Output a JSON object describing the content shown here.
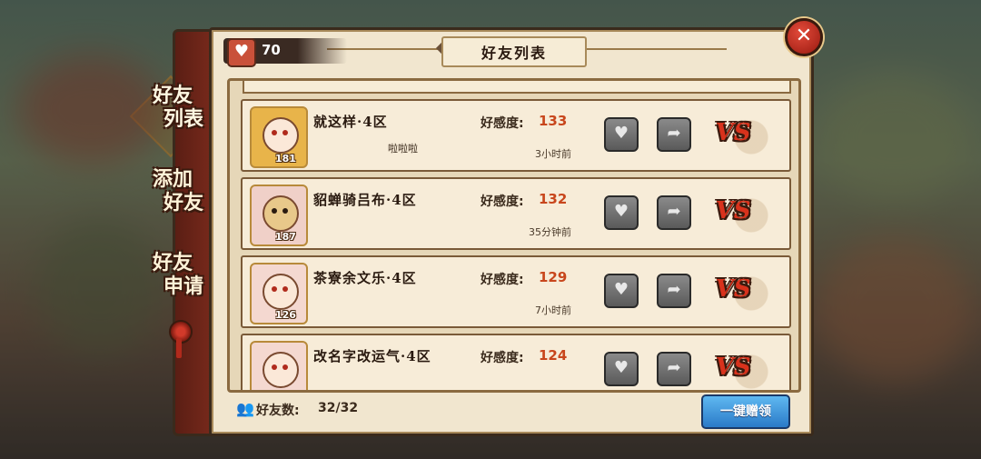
{
  "window": {
    "title": "好友列表"
  },
  "tabs": [
    {
      "line1": "好友",
      "line2": "列表",
      "active": true
    },
    {
      "line1": "添加",
      "line2": "好友",
      "active": false
    },
    {
      "line1": "好友",
      "line2": "申请",
      "active": false
    }
  ],
  "hearts": {
    "count": "70",
    "icon": "heart-icon"
  },
  "affinity_label": "好感度:",
  "friends": [
    {
      "name": "就这样·4区",
      "signature": "啦啦啦",
      "affinity": "133",
      "last_seen": "3小时前",
      "level": "181",
      "avatar_color": "#e8b44a"
    },
    {
      "name": "貂蝉骑吕布·4区",
      "signature": "",
      "affinity": "132",
      "last_seen": "35分钟前",
      "level": "187",
      "avatar_color": "#f0d0c8"
    },
    {
      "name": "茶寮余文乐·4区",
      "signature": "",
      "affinity": "129",
      "last_seen": "7小时前",
      "level": "126",
      "avatar_color": "#f4d8d0"
    },
    {
      "name": "改名字改运气·4区",
      "signature": "",
      "affinity": "124",
      "last_seen": "",
      "level": "",
      "avatar_color": "#f4d8d0"
    }
  ],
  "footer": {
    "friend_count_label": "好友数:",
    "friend_count": "32/32",
    "claim_all_label": "一键赠领"
  },
  "colors": {
    "accent": "#c8461c",
    "frame": "#3a2a1c",
    "blue_button": "#2a7ac8"
  }
}
